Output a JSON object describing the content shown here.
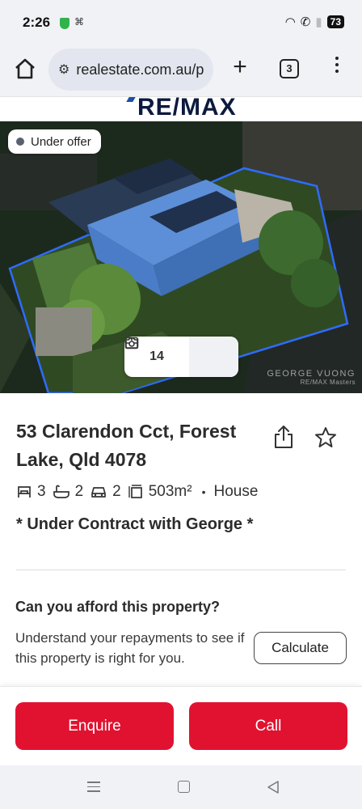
{
  "status_bar": {
    "time": "2:26",
    "battery": "73"
  },
  "browser": {
    "url": "realestate.com.au/p",
    "tab_count": "3"
  },
  "brand": {
    "logo_text": "RE/MAX"
  },
  "hero": {
    "status_badge": "Under offer",
    "photo_count": "14",
    "watermark_line1": "GEORGE VUONG",
    "watermark_line2": "RE/MAX Masters"
  },
  "listing": {
    "address": "53 Clarendon Cct, Forest Lake, Qld 4078",
    "bedrooms": "3",
    "bathrooms": "2",
    "car_spaces": "2",
    "land_size": "503m²",
    "property_type": "House",
    "headline": "* Under Contract with George *"
  },
  "affordability": {
    "title": "Can you afford this property?",
    "description": "Understand your repayments to see if this property is right for you.",
    "button_label": "Calculate"
  },
  "actions": {
    "enquire_label": "Enquire",
    "call_label": "Call"
  },
  "colors": {
    "accent_red": "#e11230",
    "brand_navy": "#0d1a3e",
    "boundary_blue": "#2f6bff"
  }
}
